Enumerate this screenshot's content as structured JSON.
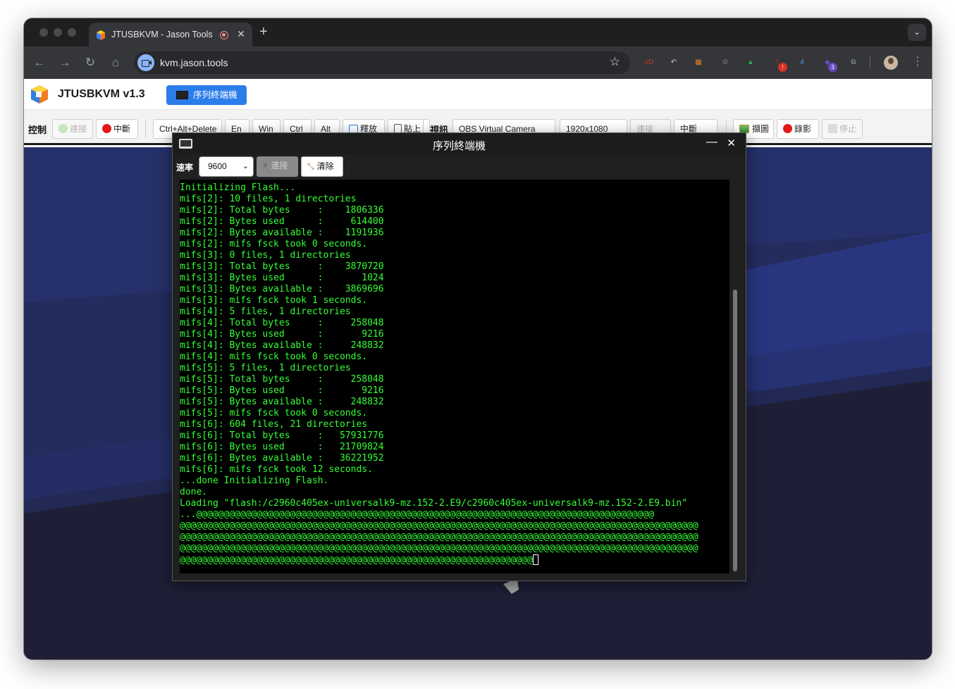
{
  "browser": {
    "tab_title": "JTUSBKVM - Jason Tools",
    "tab_close": "✕",
    "new_tab": "+",
    "tab_menu": "⌄",
    "url": "kvm.jason.tools",
    "nav": {
      "back": "←",
      "forward": "→",
      "reload": "↻",
      "home": "⌂"
    },
    "star": "☆",
    "extensions": [
      {
        "name": "ublock-icon",
        "glyph": "uD",
        "color": "#c0392b"
      },
      {
        "name": "undo-extension-icon",
        "glyph": "↶",
        "color": "#cfcfcf"
      },
      {
        "name": "grid-extension-icon",
        "glyph": "▦",
        "color": "#e67e22"
      },
      {
        "name": "gear-extension-icon",
        "glyph": "⚙",
        "color": "#7a7a7a"
      },
      {
        "name": "triangle-extension-icon",
        "glyph": "▲",
        "color": "#27ae60"
      },
      {
        "name": "alert-extension-icon",
        "glyph": "!",
        "color": "#d93025",
        "badge": "!"
      },
      {
        "name": "four-extension-icon",
        "glyph": "4",
        "color": "#4a90e2"
      },
      {
        "name": "diamond-extension-icon",
        "glyph": "◆",
        "color": "#6a4cc2",
        "badge": "3"
      },
      {
        "name": "puzzle-icon",
        "glyph": "⧉",
        "color": "#9aa0a6"
      }
    ],
    "kebab": "⋮"
  },
  "app": {
    "title": "JTUSBKVM v1.3",
    "serial_tab_label": "序列終端機",
    "controls": {
      "label": "控制",
      "connect": "連接",
      "disconnect": "中斷",
      "ctrl_alt_delete": "Ctrl+Alt+Delete",
      "en": "En",
      "win": "Win",
      "ctrl": "Ctrl",
      "alt": "Alt",
      "release": "釋放",
      "paste": "貼上",
      "video_label": "視訊",
      "camera": "OBS Virtual Camera",
      "resolution": "1920x1080",
      "video_connect": "連接",
      "video_disconnect": "中斷",
      "screenshot": "擷圖",
      "record": "錄影",
      "stop": "停止"
    }
  },
  "serial": {
    "title": "序列終端機",
    "minimize": "—",
    "close": "✕",
    "rate_label": "速率",
    "baud_rate": "9600",
    "connect": "連接",
    "clear": "清除",
    "lines": [
      "Initializing Flash...",
      "mifs[2]: 10 files, 1 directories",
      "mifs[2]: Total bytes     :    1806336",
      "mifs[2]: Bytes used      :     614400",
      "mifs[2]: Bytes available :    1191936",
      "mifs[2]: mifs fsck took 0 seconds.",
      "mifs[3]: 0 files, 1 directories",
      "mifs[3]: Total bytes     :    3870720",
      "mifs[3]: Bytes used      :       1024",
      "mifs[3]: Bytes available :    3869696",
      "mifs[3]: mifs fsck took 1 seconds.",
      "mifs[4]: 5 files, 1 directories",
      "mifs[4]: Total bytes     :     258048",
      "mifs[4]: Bytes used      :       9216",
      "mifs[4]: Bytes available :     248832",
      "mifs[4]: mifs fsck took 0 seconds.",
      "mifs[5]: 5 files, 1 directories",
      "mifs[5]: Total bytes     :     258048",
      "mifs[5]: Bytes used      :       9216",
      "mifs[5]: Bytes available :     248832",
      "mifs[5]: mifs fsck took 0 seconds.",
      "mifs[6]: 604 files, 21 directories",
      "mifs[6]: Total bytes     :   57931776",
      "mifs[6]: Bytes used      :   21709824",
      "mifs[6]: Bytes available :   36221952",
      "mifs[6]: mifs fsck took 12 seconds.",
      "...done Initializing Flash.",
      "done.",
      "Loading \"flash:/c2960c405ex-universalk9-mz.152-2.E9/c2960c405ex-universalk9-mz.152-2.E9.bin\"",
      "...@@@@@@@@@@@@@@@@@@@@@@@@@@@@@@@@@@@@@@@@@@@@@@@@@@@@@@@@@@@@@@@@@@@@@@@@@@@@@@@@@@@",
      "@@@@@@@@@@@@@@@@@@@@@@@@@@@@@@@@@@@@@@@@@@@@@@@@@@@@@@@@@@@@@@@@@@@@@@@@@@@@@@@@@@@@@@@@@@@@@@",
      "@@@@@@@@@@@@@@@@@@@@@@@@@@@@@@@@@@@@@@@@@@@@@@@@@@@@@@@@@@@@@@@@@@@@@@@@@@@@@@@@@@@@@@@@@@@@@@",
      "@@@@@@@@@@@@@@@@@@@@@@@@@@@@@@@@@@@@@@@@@@@@@@@@@@@@@@@@@@@@@@@@@@@@@@@@@@@@@@@@@@@@@@@@@@@@@@",
      "@@@@@@@@@@@@@@@@@@@@@@@@@@@@@@@@@@@@@@@@@@@@@@@@@@@@@@@@@@@@@@@@"
    ]
  }
}
